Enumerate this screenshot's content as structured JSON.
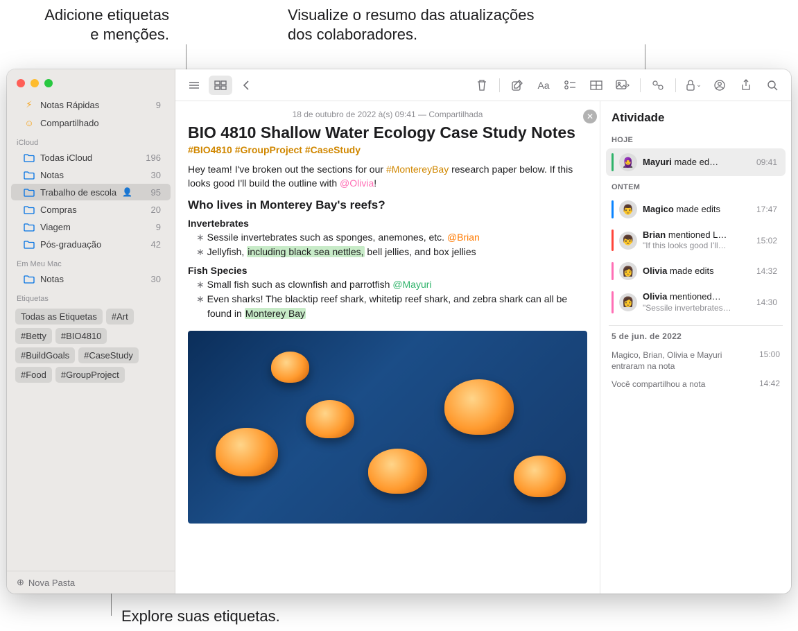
{
  "callouts": {
    "tags_mentions": "Adicione etiquetas\ne menções.",
    "activity_summary": "Visualize o resumo das atualizações\ndos colaboradores.",
    "explore_tags": "Explore suas etiquetas."
  },
  "sidebar": {
    "quick_notes": {
      "label": "Notas Rápidas",
      "count": "9"
    },
    "shared": {
      "label": "Compartilhado"
    },
    "sections": [
      {
        "header": "iCloud",
        "items": [
          {
            "label": "Todas iCloud",
            "count": "196"
          },
          {
            "label": "Notas",
            "count": "30"
          },
          {
            "label": "Trabalho de escola",
            "count": "95",
            "selected": true,
            "shared": true
          },
          {
            "label": "Compras",
            "count": "20"
          },
          {
            "label": "Viagem",
            "count": "9"
          },
          {
            "label": "Pós-graduação",
            "count": "42"
          }
        ]
      },
      {
        "header": "Em Meu Mac",
        "items": [
          {
            "label": "Notas",
            "count": "30"
          }
        ]
      }
    ],
    "tags_header": "Etiquetas",
    "tags": [
      "Todas as Etiquetas",
      "#Art",
      "#Betty",
      "#BIO4810",
      "#BuildGoals",
      "#CaseStudy",
      "#Food",
      "#GroupProject"
    ],
    "new_folder": "Nova Pasta"
  },
  "note": {
    "date": "18 de outubro de 2022 à(s) 09:41 — Compartilhada",
    "title": "BIO 4810 Shallow Water Ecology Case Study Notes",
    "tags": "#BIO4810 #GroupProject #CaseStudy",
    "intro_a": "Hey team! I've broken out the sections for our ",
    "intro_tag": "#MontereyBay",
    "intro_b": " research paper below. If this looks good I'll build the outline with ",
    "intro_mention": "@Olivia",
    "intro_c": "!",
    "h2": "Who lives in Monterey Bay's reefs?",
    "invert_head": "Invertebrates",
    "invert_1a": "Sessile invertebrates such as sponges, anemones, etc. ",
    "invert_1m": "@Brian",
    "invert_2a": "Jellyfish, ",
    "invert_2hl": "including black sea nettles,",
    "invert_2b": " bell jellies, and box jellies",
    "fish_head": "Fish Species",
    "fish_1a": "Small fish such as clownfish and parrotfish ",
    "fish_1m": "@Mayuri",
    "fish_2a": "Even sharks! The blacktip reef shark, whitetip reef shark, and zebra shark can all be found in ",
    "fish_2hl": "Monterey Bay"
  },
  "activity": {
    "title": "Atividade",
    "sections": [
      {
        "header": "HOJE",
        "items": [
          {
            "bar": "#2fb36a",
            "avatar": "🧕",
            "text_bold": "Mayuri",
            "text_rest": " made ed…",
            "time": "09:41",
            "selected": true
          }
        ]
      },
      {
        "header": "ONTEM",
        "items": [
          {
            "bar": "#0a84ff",
            "avatar": "👨",
            "text_bold": "Magico",
            "text_rest": " made edits",
            "time": "17:47"
          },
          {
            "bar": "#ff453a",
            "avatar": "👦",
            "text_bold": "Brian",
            "text_rest": " mentioned L…",
            "sub": "\"If this looks good I'll…",
            "time": "15:02"
          },
          {
            "bar": "#ff6fb5",
            "avatar": "👩",
            "text_bold": "Olivia",
            "text_rest": " made edits",
            "time": "14:32"
          },
          {
            "bar": "#ff6fb5",
            "avatar": "👩",
            "text_bold": "Olivia",
            "text_rest": " mentioned…",
            "sub": "\"Sessile invertebrates…",
            "time": "14:30"
          }
        ]
      }
    ],
    "older_header": "5 de jun. de 2022",
    "older": [
      {
        "text": "Magico, Brian, Olivia e Mayuri entraram na nota",
        "time": "15:00"
      },
      {
        "text": "Você compartilhou a nota",
        "time": "14:42"
      }
    ]
  }
}
